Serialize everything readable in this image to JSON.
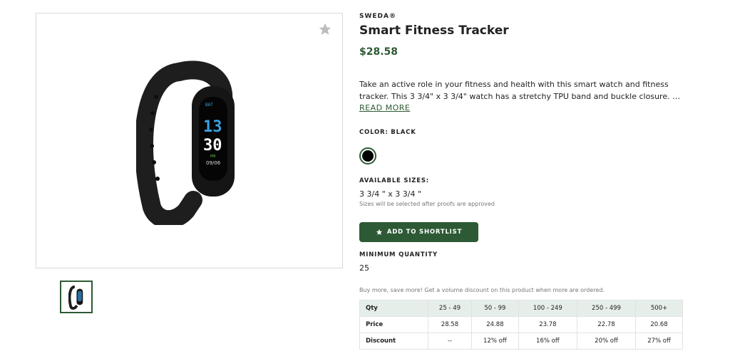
{
  "product": {
    "brand": "SWEDA®",
    "name": "Smart Fitness Tracker",
    "price": "$28.58",
    "description_line1": "Take an active role in your fitness and health with this smart watch and fitness",
    "description_line2": "tracker. This 3 3/4\" x 3 3/4\" watch has a stretchy TPU band and buckle closure. This smart watch and fitness tracker",
    "read_more": "READ MORE",
    "color_label": "COLOR: BLACK",
    "swatch_color": "#000000",
    "sizes_label": "AVAILABLE SIZES:",
    "size_value": "3 3/4 \" x 3 3/4 \"",
    "size_note": "Sizes will be selected after proofs are approved",
    "shortlist_label": "ADD TO SHORTLIST",
    "min_qty_label": "MINIMUM QUANTITY",
    "min_qty_value": "25",
    "volume_note": "Buy more, save more! Get a volume discount on this product when more are ordered.",
    "screen_text": {
      "top": "13",
      "bottom": "30",
      "date": "09/06"
    }
  },
  "pricing_table": {
    "rows": [
      [
        "Qty",
        "25 - 49",
        "50 - 99",
        "100 - 249",
        "250 - 499",
        "500+"
      ],
      [
        "Price",
        "28.58",
        "24.88",
        "23.78",
        "22.78",
        "20.68"
      ],
      [
        "Discount",
        "--",
        "12% off",
        "16% off",
        "20% off",
        "27% off"
      ]
    ]
  },
  "icons": {
    "favorite": "star-icon",
    "shortlist": "star-icon"
  },
  "colors": {
    "accent": "#2d5a34",
    "table_header": "#e6eee9"
  }
}
